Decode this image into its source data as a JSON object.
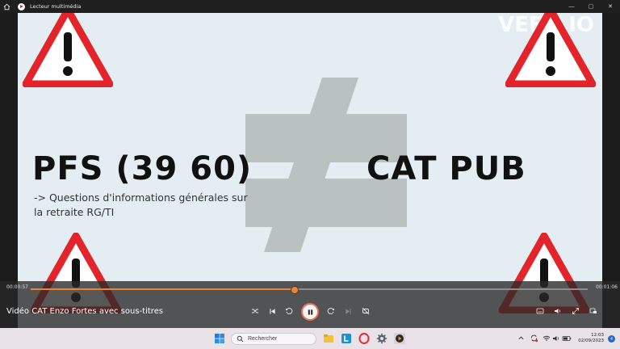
{
  "window": {
    "title": "Lecteur multimédia",
    "minimize_glyph": "—",
    "maximize_glyph": "▢",
    "close_glyph": "✕"
  },
  "video": {
    "watermark": "VEED.IO",
    "left_heading": "PFS (39 60)",
    "right_heading": "CAT PUB",
    "subtitle_line1": "-> Questions d'informations générales sur",
    "subtitle_line2": "la retraite RG/TI",
    "colors": {
      "background": "#e3edf2",
      "sign_red": "#e3242b",
      "neq_gray": "#b9c1c1"
    }
  },
  "player": {
    "current_time": "00:00:57",
    "total_time": "00:01:06",
    "progress": 0.473,
    "media_title": "Vidéo CAT Enzo Fortes avec sous-titres",
    "accent": "#e8843b"
  },
  "taskbar": {
    "search_placeholder": "Rechercher",
    "time": "12:03",
    "date": "02/09/2023",
    "notification_count": "4"
  }
}
